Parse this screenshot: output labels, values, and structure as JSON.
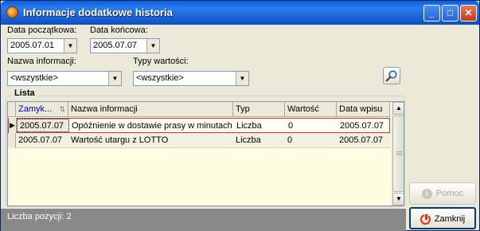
{
  "window": {
    "title": "Informacje dodatkowe historia",
    "title_icon": "app-orange-icon",
    "minimize": "_",
    "maximize": "□",
    "close": "✕"
  },
  "filters": {
    "date_from_label": "Data początkowa:",
    "date_from_value": "2005.07.01",
    "date_to_label": "Data końcowa:",
    "date_to_value": "2005.07.07",
    "info_name_label": "Nazwa informacji:",
    "info_name_value": "<wszystkie>",
    "value_types_label": "Typy wartości:",
    "value_types_value": "<wszystkie>",
    "search_icon": "magnifier-icon"
  },
  "list": {
    "group_title": "Lista",
    "columns": [
      "Zamyk...",
      "Nazwa informacji",
      "Typ",
      "Wartość",
      "Data wpisu"
    ],
    "rows": [
      {
        "zamyk": "2005.07.07",
        "nazwa": "Opóźnienie w dostawie prasy w minutach",
        "typ": "Liczba",
        "wartosc": "0",
        "data": "2005.07.07"
      },
      {
        "zamyk": "2005.07.07",
        "nazwa": "Wartość utargu z LOTTO",
        "typ": "Liczba",
        "wartosc": "0",
        "data": "2005.07.07"
      }
    ]
  },
  "status": {
    "count_text": "Liczba pozycji: 2"
  },
  "buttons": {
    "help": "Pomoc",
    "close": "Zamknij"
  },
  "colors": {
    "titlebar": "#2b7cef",
    "selected_row_border": "#e03030",
    "grid_background": "#fffde1",
    "statusbar": "#898989"
  }
}
